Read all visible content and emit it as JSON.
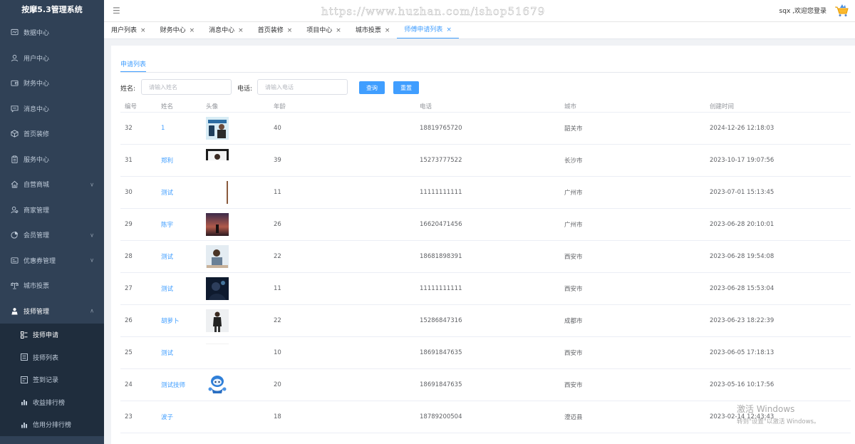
{
  "app": {
    "title": "按摩5.3管理系统"
  },
  "header": {
    "watermark": "https://www.huzhan.com/ishop51679",
    "welcome": "sqx ,欢迎您登录"
  },
  "sidebar": {
    "items": [
      {
        "label": "数据中心",
        "icon": "monitor-icon"
      },
      {
        "label": "用户中心",
        "icon": "user-icon"
      },
      {
        "label": "财务中心",
        "icon": "wallet-icon"
      },
      {
        "label": "消息中心",
        "icon": "message-icon"
      },
      {
        "label": "首页装修",
        "icon": "cube-icon"
      },
      {
        "label": "服务中心",
        "icon": "clipboard-icon"
      },
      {
        "label": "自营商城",
        "icon": "home-icon"
      },
      {
        "label": "商家管理",
        "icon": "merchant-icon"
      },
      {
        "label": "会员管理",
        "icon": "pie-icon"
      },
      {
        "label": "优惠券管理",
        "icon": "coupon-icon"
      },
      {
        "label": "城市投票",
        "icon": "vote-icon"
      },
      {
        "label": "技师管理",
        "icon": "technician-icon"
      }
    ],
    "subitems": [
      {
        "label": "技师申请",
        "icon": "apply-icon"
      },
      {
        "label": "技师列表",
        "icon": "list-icon"
      },
      {
        "label": "签到记录",
        "icon": "checkin-icon"
      },
      {
        "label": "收益排行榜",
        "icon": "bar-chart-icon"
      },
      {
        "label": "信用分排行榜",
        "icon": "bar-chart-icon"
      }
    ]
  },
  "tabs": [
    {
      "label": "用户列表"
    },
    {
      "label": "财务中心"
    },
    {
      "label": "消息中心"
    },
    {
      "label": "首页装修"
    },
    {
      "label": "项目中心"
    },
    {
      "label": "城市投票"
    },
    {
      "label": "师傅申请列表",
      "active": true
    }
  ],
  "page": {
    "subtab": "申请列表"
  },
  "filter": {
    "name_label": "姓名:",
    "name_placeholder": "请输入姓名",
    "phone_label": "电话:",
    "phone_placeholder": "请输入电话",
    "query_label": "查询",
    "reset_label": "重置"
  },
  "table": {
    "headers": {
      "id": "编号",
      "name": "姓名",
      "avatar": "头像",
      "age": "年龄",
      "phone": "电话",
      "city": "城市",
      "created": "创建时间"
    },
    "rows": [
      {
        "id": "32",
        "name": "1",
        "age": "40",
        "phone": "18819765720",
        "city": "韶关市",
        "created": "2024-12-26 12:18:03",
        "avatar": "phone-poster"
      },
      {
        "id": "31",
        "name": "郑利",
        "age": "39",
        "phone": "15273777522",
        "city": "长沙市",
        "created": "2023-10-17 19:07:56",
        "avatar": "portrait-dark"
      },
      {
        "id": "30",
        "name": "测试",
        "age": "11",
        "phone": "11111111111",
        "city": "广州市",
        "created": "2023-07-01 15:13:45",
        "avatar": "thin-bar"
      },
      {
        "id": "29",
        "name": "陈宇",
        "age": "26",
        "phone": "16620471456",
        "city": "广州市",
        "created": "2023-06-28 20:10:01",
        "avatar": "sunset"
      },
      {
        "id": "28",
        "name": "测试",
        "age": "22",
        "phone": "18681898391",
        "city": "西安市",
        "created": "2023-06-28 19:54:08",
        "avatar": "child-photo"
      },
      {
        "id": "27",
        "name": "测试",
        "age": "11",
        "phone": "11111111111",
        "city": "西安市",
        "created": "2023-06-28 15:53:04",
        "avatar": "dark-portrait"
      },
      {
        "id": "26",
        "name": "胡萝卜",
        "age": "22",
        "phone": "15286847316",
        "city": "成都市",
        "created": "2023-06-23 18:22:39",
        "avatar": "standing-person"
      },
      {
        "id": "25",
        "name": "测试",
        "age": "10",
        "phone": "18691847635",
        "city": "西安市",
        "created": "2023-06-05 17:18:13",
        "avatar": "blank-strip"
      },
      {
        "id": "24",
        "name": "测试技师",
        "age": "20",
        "phone": "18691847635",
        "city": "西安市",
        "created": "2023-05-16 10:17:56",
        "avatar": "blue-robot"
      },
      {
        "id": "23",
        "name": "波子",
        "age": "18",
        "phone": "18789200504",
        "city": "澄迈县",
        "created": "2023-02-14 12:43:43",
        "avatar": "none"
      }
    ]
  },
  "windows": {
    "line1": "激活 Windows",
    "line2": "转到\"设置\"以激活 Windows。"
  },
  "colors": {
    "sidebar": "#304156",
    "submenu": "#1f2d3d",
    "accent": "#409eff"
  }
}
